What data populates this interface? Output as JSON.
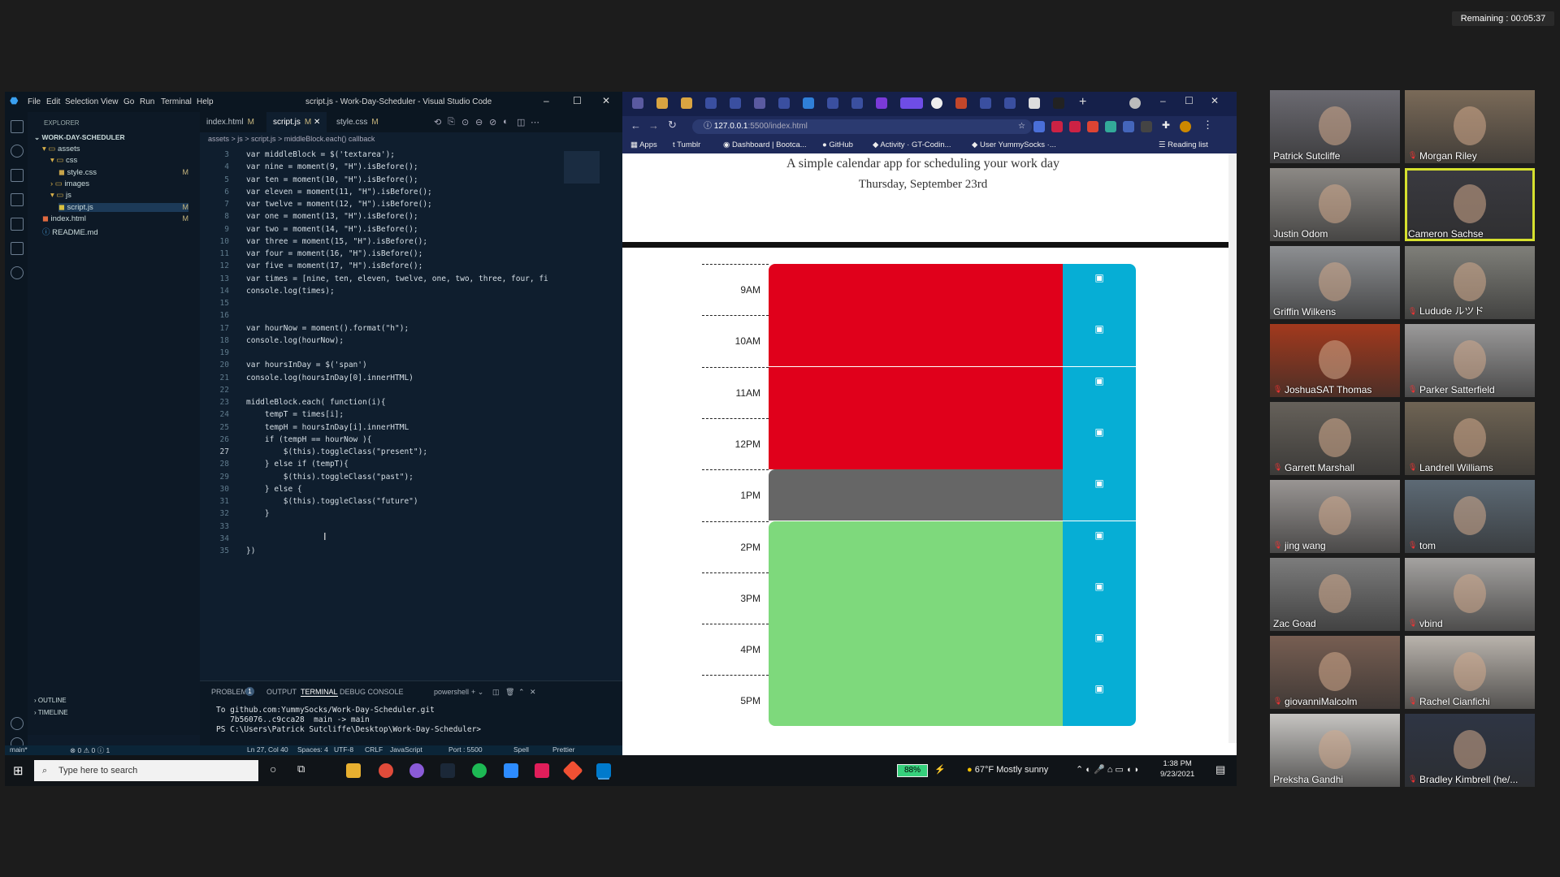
{
  "remaining": "Remaining : 00:05:37",
  "vscode": {
    "menu": [
      "File",
      "Edit",
      "Selection",
      "View",
      "Go",
      "Run",
      "Terminal",
      "Help"
    ],
    "title": "script.js - Work-Day-Scheduler - Visual Studio Code",
    "explorer": {
      "header": "EXPLORER",
      "project": "WORK-DAY-SCHEDULER",
      "items": [
        {
          "label": "assets",
          "indent": 1,
          "kind": "folder-open"
        },
        {
          "label": "css",
          "indent": 2,
          "kind": "folder-open"
        },
        {
          "label": "style.css",
          "indent": 3,
          "kind": "css",
          "mark": "M"
        },
        {
          "label": "images",
          "indent": 2,
          "kind": "folder"
        },
        {
          "label": "js",
          "indent": 2,
          "kind": "folder-open"
        },
        {
          "label": "script.js",
          "indent": 3,
          "kind": "js",
          "mark": "M"
        },
        {
          "label": "index.html",
          "indent": 1,
          "kind": "html",
          "mark": "M"
        },
        {
          "label": "README.md",
          "indent": 1,
          "kind": "info"
        }
      ],
      "outline": "OUTLINE",
      "timeline": "TIMELINE"
    },
    "tabs": [
      {
        "label": "index.html",
        "mark": "M"
      },
      {
        "label": "script.js",
        "mark": "M",
        "active": true
      },
      {
        "label": "style.css",
        "mark": "M"
      }
    ],
    "breadcrumb": "assets > js > script.js > middleBlock.each() callback",
    "code": [
      {
        "n": "3",
        "t": "var middleBlock = $('textarea');"
      },
      {
        "n": "4",
        "t": "var nine = moment(9, \"H\").isBefore();"
      },
      {
        "n": "5",
        "t": "var ten = moment(10, \"H\").isBefore();"
      },
      {
        "n": "6",
        "t": "var eleven = moment(11, \"H\").isBefore();"
      },
      {
        "n": "7",
        "t": "var twelve = moment(12, \"H\").isBefore();"
      },
      {
        "n": "8",
        "t": "var one = moment(13, \"H\").isBefore();"
      },
      {
        "n": "9",
        "t": "var two = moment(14, \"H\").isBefore();"
      },
      {
        "n": "10",
        "t": "var three = moment(15, \"H\").isBefore();"
      },
      {
        "n": "11",
        "t": "var four = moment(16, \"H\").isBefore();"
      },
      {
        "n": "12",
        "t": "var five = moment(17, \"H\").isBefore();"
      },
      {
        "n": "13",
        "t": "var times = [nine, ten, eleven, twelve, one, two, three, four, fi"
      },
      {
        "n": "14",
        "t": "console.log(times);"
      },
      {
        "n": "15",
        "t": ""
      },
      {
        "n": "16",
        "t": ""
      },
      {
        "n": "17",
        "t": "var hourNow = moment().format(\"h\");"
      },
      {
        "n": "18",
        "t": "console.log(hourNow);"
      },
      {
        "n": "19",
        "t": ""
      },
      {
        "n": "20",
        "t": "var hoursInDay = $('span')"
      },
      {
        "n": "21",
        "t": "console.log(hoursInDay[0].innerHTML)"
      },
      {
        "n": "22",
        "t": ""
      },
      {
        "n": "23",
        "t": "middleBlock.each( function(i){"
      },
      {
        "n": "24",
        "t": "    tempT = times[i];"
      },
      {
        "n": "25",
        "t": "    tempH = hoursInDay[i].innerHTML"
      },
      {
        "n": "26",
        "t": "    if (tempH == hourNow ){"
      },
      {
        "n": "27",
        "t": "        $(this).toggleClass(\"present\");"
      },
      {
        "n": "28",
        "t": "    } else if (tempT){"
      },
      {
        "n": "29",
        "t": "        $(this).toggleClass(\"past\");"
      },
      {
        "n": "30",
        "t": "    } else {"
      },
      {
        "n": "31",
        "t": "        $(this).toggleClass(\"future\")"
      },
      {
        "n": "32",
        "t": "    }"
      },
      {
        "n": "33",
        "t": ""
      },
      {
        "n": "34",
        "t": ""
      },
      {
        "n": "35",
        "t": "})"
      }
    ],
    "panel": {
      "tabs": [
        "PROBLEMS",
        "OUTPUT",
        "TERMINAL",
        "DEBUG CONSOLE"
      ],
      "problems_count": "1",
      "shell": "powershell",
      "terminal": [
        "To github.com:YummySocks/Work-Day-Scheduler.git",
        "   7b56076..c9cca28  main -> main",
        "PS C:\\Users\\Patrick Sutcliffe\\Desktop\\Work-Day-Scheduler> "
      ]
    },
    "status": {
      "branch": "main*",
      "errors": "⊗ 0 ⚠ 0 ⓘ 1",
      "position": "Ln 27, Col 40",
      "spaces": "Spaces: 4",
      "encoding": "UTF-8",
      "eol": "CRLF",
      "language": "JavaScript",
      "port": "Port : 5500",
      "spell": "Spell",
      "prettier": "Prettier"
    }
  },
  "browser": {
    "url_host": "127.0.0.1",
    "url_rest": ":5500/index.html",
    "bookmarks": [
      "Apps",
      "Tumblr",
      "Dashboard | Bootca...",
      "GitHub",
      "Activity · GT-Codin...",
      "User YummySocks ·..."
    ],
    "reading_list": "Reading list",
    "page": {
      "subtitle": "A simple calendar app for scheduling your work day",
      "date": "Thursday, September 23rd",
      "hours": [
        {
          "label": "9AM",
          "state": "past"
        },
        {
          "label": "10AM",
          "state": "past"
        },
        {
          "label": "11AM",
          "state": "past"
        },
        {
          "label": "12PM",
          "state": "past"
        },
        {
          "label": "1PM",
          "state": "present"
        },
        {
          "label": "2PM",
          "state": "future"
        },
        {
          "label": "3PM",
          "state": "future"
        },
        {
          "label": "4PM",
          "state": "future"
        },
        {
          "label": "5PM",
          "state": "future"
        }
      ]
    }
  },
  "taskbar": {
    "search_placeholder": "Type here to search",
    "battery": "88%",
    "weather": "67°F  Mostly sunny",
    "time": "1:38 PM",
    "date": "9/23/2021"
  },
  "participants": [
    {
      "name": "Patrick Sutcliffe",
      "muted": false,
      "bg": "#6b6a71"
    },
    {
      "name": "Morgan Riley",
      "muted": true,
      "bg": "#7a6a58"
    },
    {
      "name": "Justin Odom",
      "muted": false,
      "bg": "#8c8985"
    },
    {
      "name": "Cameron Sachse",
      "muted": false,
      "bg": "#3a3a40",
      "speaking": true
    },
    {
      "name": "Griffin Wilkens",
      "muted": false,
      "bg": "#8d8f92"
    },
    {
      "name": "Ludude ルツド",
      "muted": true,
      "bg": "#7f7f79"
    },
    {
      "name": "JoshuaSAT Thomas",
      "muted": true,
      "bg": "#a2391d"
    },
    {
      "name": "Parker Satterfield",
      "muted": true,
      "bg": "#9b9a9a"
    },
    {
      "name": "Garrett Marshall",
      "muted": true,
      "bg": "#66615a"
    },
    {
      "name": "Landrell Williams",
      "muted": true,
      "bg": "#6f6454"
    },
    {
      "name": "jing wang",
      "muted": true,
      "bg": "#999593"
    },
    {
      "name": "tom",
      "muted": true,
      "bg": "#5d6a75"
    },
    {
      "name": "Zac Goad",
      "muted": false,
      "bg": "#7c7c7c"
    },
    {
      "name": "vbind",
      "muted": true,
      "bg": "#a4a2a0"
    },
    {
      "name": "giovanniMalcolm",
      "muted": true,
      "bg": "#775e52"
    },
    {
      "name": "Rachel Cianfichi",
      "muted": true,
      "bg": "#b9b3ac"
    },
    {
      "name": "Preksha Gandhi",
      "muted": false,
      "bg": "#c6c4c1"
    },
    {
      "name": "Bradley Kimbrell (he/...",
      "muted": true,
      "bg": "#2e3544"
    }
  ],
  "colors": {
    "past": "#e0001b",
    "present": "#666666",
    "future": "#7ed97c",
    "save": "#06aed5",
    "speaking": "#d6e02e"
  }
}
